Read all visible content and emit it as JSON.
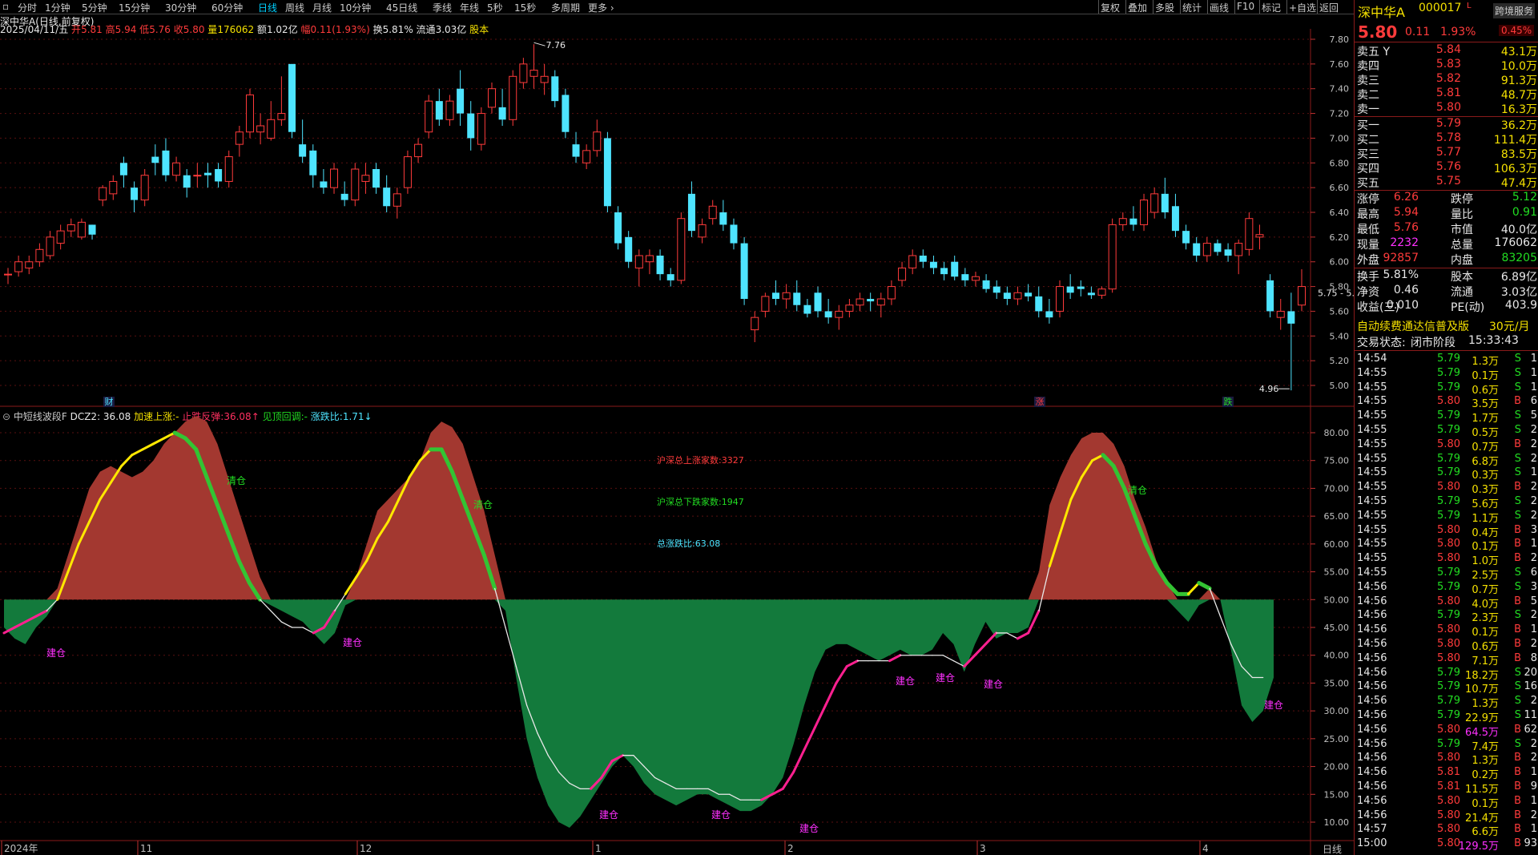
{
  "toolbar": {
    "periods": [
      "分时",
      "1分钟",
      "5分钟",
      "15分钟",
      "30分钟",
      "60分钟",
      "日线",
      "周线",
      "月线",
      "10分钟",
      "45日线",
      "季线",
      "年线",
      "5秒",
      "15秒",
      "多周期",
      "更多"
    ],
    "active": "日线",
    "right_buttons": [
      "复权",
      "叠加",
      "多股",
      "统计",
      "画线",
      "F10",
      "标记",
      "+自选",
      "返回"
    ]
  },
  "info": {
    "title": "深中华A(日线,前复权)",
    "date": "2025/04/11/五",
    "open_label": "开",
    "open": "5.81",
    "high_label": "高",
    "high": "5.94",
    "low_label": "低",
    "low": "5.76",
    "close_label": "收",
    "close": "5.80",
    "vol_label": "量",
    "vol": "176062",
    "amt_label": "额",
    "amt": "1.02亿",
    "chg_label": "幅",
    "chg": "0.11(1.93%)",
    "turn_label": "换",
    "turn": "5.81%",
    "float_label": "流通",
    "float": "3.03亿",
    "badge": "股本"
  },
  "kline": {
    "yaxis": [
      "7.80",
      "7.60",
      "7.40",
      "7.20",
      "7.00",
      "6.80",
      "6.60",
      "6.40",
      "6.20",
      "6.00",
      "5.80",
      "5.60",
      "5.40",
      "5.20",
      "5.00"
    ],
    "ymax": 7.8,
    "ymin": 5.0,
    "max_label": "7.76",
    "min_label": "4.96",
    "range_label": "5.75 - 5.76",
    "markers": [
      "财",
      "涨",
      "跌"
    ],
    "candles": [
      [
        5.9,
        5.95,
        5.82,
        5.9
      ],
      [
        5.92,
        6.05,
        5.88,
        6.0
      ],
      [
        5.95,
        6.05,
        5.9,
        6.0
      ],
      [
        6.0,
        6.15,
        5.96,
        6.1
      ],
      [
        6.05,
        6.25,
        6.02,
        6.2
      ],
      [
        6.15,
        6.3,
        6.1,
        6.25
      ],
      [
        6.25,
        6.35,
        6.2,
        6.3
      ],
      [
        6.2,
        6.35,
        6.18,
        6.32
      ],
      [
        6.3,
        6.3,
        6.18,
        6.22
      ],
      [
        6.5,
        6.62,
        6.45,
        6.6
      ],
      [
        6.55,
        6.7,
        6.5,
        6.65
      ],
      [
        6.8,
        6.85,
        6.6,
        6.7
      ],
      [
        6.6,
        6.65,
        6.4,
        6.5
      ],
      [
        6.5,
        6.75,
        6.45,
        6.7
      ],
      [
        6.85,
        6.95,
        6.7,
        6.8
      ],
      [
        6.9,
        7.0,
        6.65,
        6.7
      ],
      [
        6.7,
        6.85,
        6.65,
        6.8
      ],
      [
        6.7,
        6.75,
        6.52,
        6.6
      ],
      [
        6.7,
        6.8,
        6.6,
        6.7
      ],
      [
        6.72,
        6.8,
        6.6,
        6.7
      ],
      [
        6.75,
        6.8,
        6.6,
        6.65
      ],
      [
        6.65,
        6.9,
        6.6,
        6.85
      ],
      [
        6.95,
        7.1,
        6.85,
        7.05
      ],
      [
        7.05,
        7.4,
        7.0,
        7.35
      ],
      [
        7.05,
        7.2,
        6.95,
        7.1
      ],
      [
        7.0,
        7.3,
        6.98,
        7.15
      ],
      [
        7.15,
        7.5,
        7.1,
        7.2
      ],
      [
        7.6,
        7.6,
        7.0,
        7.05
      ],
      [
        6.95,
        7.15,
        6.8,
        6.85
      ],
      [
        6.9,
        6.95,
        6.6,
        6.7
      ],
      [
        6.65,
        6.75,
        6.55,
        6.6
      ],
      [
        6.6,
        6.8,
        6.55,
        6.75
      ],
      [
        6.55,
        6.65,
        6.45,
        6.5
      ],
      [
        6.5,
        6.8,
        6.45,
        6.75
      ],
      [
        6.65,
        6.8,
        6.55,
        6.7
      ],
      [
        6.75,
        6.8,
        6.55,
        6.6
      ],
      [
        6.6,
        6.7,
        6.4,
        6.45
      ],
      [
        6.45,
        6.6,
        6.35,
        6.55
      ],
      [
        6.6,
        6.9,
        6.55,
        6.85
      ],
      [
        6.85,
        7.0,
        6.8,
        6.95
      ],
      [
        7.05,
        7.35,
        7.0,
        7.3
      ],
      [
        7.3,
        7.4,
        7.1,
        7.15
      ],
      [
        7.15,
        7.35,
        7.1,
        7.3
      ],
      [
        7.4,
        7.55,
        7.1,
        7.2
      ],
      [
        7.2,
        7.3,
        6.9,
        7.0
      ],
      [
        6.95,
        7.25,
        6.9,
        7.2
      ],
      [
        7.25,
        7.45,
        7.2,
        7.4
      ],
      [
        7.25,
        7.4,
        7.1,
        7.15
      ],
      [
        7.15,
        7.55,
        7.1,
        7.5
      ],
      [
        7.45,
        7.65,
        7.4,
        7.6
      ],
      [
        7.5,
        7.76,
        7.4,
        7.55
      ],
      [
        7.45,
        7.6,
        7.35,
        7.5
      ],
      [
        7.5,
        7.55,
        7.25,
        7.3
      ],
      [
        7.35,
        7.4,
        7.0,
        7.05
      ],
      [
        6.95,
        7.05,
        6.8,
        6.85
      ],
      [
        6.8,
        6.95,
        6.75,
        6.9
      ],
      [
        6.9,
        7.15,
        6.85,
        7.05
      ],
      [
        7.0,
        7.05,
        6.4,
        6.45
      ],
      [
        6.4,
        6.45,
        6.1,
        6.15
      ],
      [
        6.2,
        6.25,
        5.95,
        6.0
      ],
      [
        5.95,
        6.1,
        5.8,
        6.05
      ],
      [
        6.0,
        6.1,
        5.9,
        6.05
      ],
      [
        6.05,
        6.1,
        5.85,
        5.9
      ],
      [
        5.9,
        5.95,
        5.8,
        5.85
      ],
      [
        5.85,
        6.4,
        5.82,
        6.35
      ],
      [
        6.55,
        6.65,
        6.2,
        6.25
      ],
      [
        6.2,
        6.35,
        6.15,
        6.3
      ],
      [
        6.35,
        6.5,
        6.3,
        6.45
      ],
      [
        6.4,
        6.5,
        6.25,
        6.3
      ],
      [
        6.3,
        6.35,
        6.1,
        6.15
      ],
      [
        6.15,
        6.2,
        5.65,
        5.7
      ],
      [
        5.45,
        5.6,
        5.35,
        5.55
      ],
      [
        5.6,
        5.75,
        5.55,
        5.72
      ],
      [
        5.75,
        5.85,
        5.65,
        5.7
      ],
      [
        5.7,
        5.82,
        5.62,
        5.75
      ],
      [
        5.75,
        5.85,
        5.6,
        5.65
      ],
      [
        5.65,
        5.7,
        5.55,
        5.58
      ],
      [
        5.75,
        5.8,
        5.55,
        5.6
      ],
      [
        5.6,
        5.7,
        5.5,
        5.55
      ],
      [
        5.55,
        5.65,
        5.45,
        5.6
      ],
      [
        5.6,
        5.7,
        5.55,
        5.65
      ],
      [
        5.65,
        5.75,
        5.6,
        5.7
      ],
      [
        5.7,
        5.75,
        5.6,
        5.68
      ],
      [
        5.65,
        5.75,
        5.55,
        5.7
      ],
      [
        5.7,
        5.85,
        5.65,
        5.8
      ],
      [
        5.85,
        6.0,
        5.8,
        5.95
      ],
      [
        5.95,
        6.1,
        5.9,
        6.05
      ],
      [
        6.05,
        6.1,
        5.95,
        6.0
      ],
      [
        6.0,
        6.05,
        5.9,
        5.95
      ],
      [
        5.95,
        6.0,
        5.85,
        5.9
      ],
      [
        6.0,
        6.05,
        5.85,
        5.88
      ],
      [
        5.9,
        5.95,
        5.8,
        5.85
      ],
      [
        5.85,
        5.92,
        5.8,
        5.88
      ],
      [
        5.85,
        5.9,
        5.75,
        5.78
      ],
      [
        5.8,
        5.85,
        5.7,
        5.75
      ],
      [
        5.75,
        5.8,
        5.65,
        5.7
      ],
      [
        5.7,
        5.8,
        5.65,
        5.75
      ],
      [
        5.75,
        5.82,
        5.68,
        5.72
      ],
      [
        5.72,
        5.8,
        5.55,
        5.6
      ],
      [
        5.6,
        5.7,
        5.5,
        5.55
      ],
      [
        5.6,
        5.85,
        5.55,
        5.8
      ],
      [
        5.8,
        5.9,
        5.7,
        5.75
      ],
      [
        5.8,
        5.85,
        5.72,
        5.78
      ],
      [
        5.75,
        5.8,
        5.7,
        5.73
      ],
      [
        5.73,
        5.8,
        5.7,
        5.78
      ],
      [
        5.78,
        6.35,
        5.75,
        6.3
      ],
      [
        6.3,
        6.4,
        6.25,
        6.35
      ],
      [
        6.35,
        6.45,
        6.25,
        6.3
      ],
      [
        6.3,
        6.55,
        6.25,
        6.5
      ],
      [
        6.4,
        6.6,
        6.35,
        6.55
      ],
      [
        6.55,
        6.68,
        6.35,
        6.4
      ],
      [
        6.45,
        6.55,
        6.2,
        6.25
      ],
      [
        6.25,
        6.3,
        6.1,
        6.15
      ],
      [
        6.15,
        6.2,
        6.0,
        6.05
      ],
      [
        6.05,
        6.2,
        6.0,
        6.15
      ],
      [
        6.15,
        6.18,
        6.05,
        6.08
      ],
      [
        6.1,
        6.15,
        6.0,
        6.05
      ],
      [
        6.05,
        6.18,
        5.9,
        6.15
      ],
      [
        6.1,
        6.4,
        6.05,
        6.35
      ],
      [
        6.2,
        6.3,
        6.1,
        6.22
      ],
      [
        5.85,
        5.9,
        5.55,
        5.6
      ],
      [
        5.55,
        5.7,
        5.45,
        5.6
      ],
      [
        5.6,
        5.75,
        4.96,
        5.5
      ],
      [
        5.65,
        5.94,
        5.6,
        5.8
      ]
    ]
  },
  "indicator": {
    "name": "中短线波段F",
    "dcz2_label": "DCZ2:",
    "dcz2": "36.08",
    "legend": [
      "加速上涨:-",
      "止跌反弹:36.08",
      "见顶回调:-",
      "涨跌比:1.71"
    ],
    "yaxis": [
      "80.00",
      "75.00",
      "70.00",
      "65.00",
      "60.00",
      "55.00",
      "50.00",
      "45.00",
      "40.00",
      "35.00",
      "30.00",
      "25.00",
      "20.00",
      "15.00",
      "10.00"
    ],
    "text_up": "沪深总上涨家数:3327",
    "text_down": "沪深总下跌家数:1947",
    "text_ratio": "总涨跌比:63.08",
    "label_build": "建仓",
    "label_clear": "清仓",
    "curve": [
      44,
      45,
      46,
      47,
      48,
      50,
      55,
      60,
      64,
      68,
      71,
      74,
      76,
      77,
      78,
      79,
      80,
      79,
      77,
      72,
      67,
      62,
      57,
      53,
      50,
      48,
      46,
      45,
      45,
      44,
      45,
      48,
      51,
      54,
      57,
      61,
      64,
      68,
      72,
      75,
      77,
      77,
      73,
      68,
      63,
      58,
      52,
      45,
      38,
      31,
      26,
      22,
      19,
      17,
      16,
      16,
      18,
      21,
      22,
      22,
      20,
      18,
      17,
      16,
      16,
      16,
      16,
      15,
      15,
      14,
      14,
      14,
      15,
      16,
      19,
      23,
      27,
      31,
      35,
      38,
      39,
      39,
      39,
      39,
      40,
      40,
      40,
      40,
      40,
      39,
      38,
      40,
      42,
      44,
      44,
      43,
      44,
      48,
      56,
      62,
      68,
      72,
      75,
      76,
      74,
      70,
      65,
      60,
      56,
      53,
      51,
      51,
      53,
      52,
      47,
      42,
      38,
      36,
      36
    ],
    "fill": [
      45,
      43,
      42,
      45,
      47,
      52,
      58,
      64,
      70,
      73,
      74,
      73,
      72,
      73,
      75,
      78,
      80,
      82,
      83,
      82,
      78,
      72,
      66,
      60,
      54,
      49,
      48,
      47,
      46,
      44,
      42,
      44,
      49,
      54,
      60,
      66,
      68,
      70,
      72,
      75,
      80,
      82,
      81,
      78,
      72,
      66,
      58,
      48,
      36,
      25,
      18,
      13,
      10,
      9,
      11,
      14,
      17,
      20,
      22,
      20,
      17,
      15,
      14,
      13,
      14,
      15,
      15,
      14,
      13,
      12,
      12,
      13,
      15,
      18,
      24,
      31,
      37,
      41,
      42,
      42,
      41,
      40,
      39,
      40,
      41,
      40,
      40,
      41,
      44,
      42,
      37,
      42,
      46,
      43,
      44,
      44,
      45,
      55,
      67,
      72,
      76,
      79,
      80,
      80,
      78,
      74,
      68,
      63,
      57,
      53,
      48,
      46,
      49,
      52,
      50,
      41,
      31,
      28,
      30,
      36
    ]
  },
  "xaxis": [
    "2024年",
    "11",
    "12",
    "1",
    "2",
    "3",
    "4"
  ],
  "right_panel": {
    "name": "深中华A",
    "code": "000017",
    "flag": "L",
    "button": "跨境服务",
    "price": "5.80",
    "change": "0.11",
    "pct": "1.93%",
    "pct_box": "0.45%",
    "sells": [
      {
        "label": "卖五",
        "mark": "Y",
        "price": "5.84",
        "vol": "43.1万"
      },
      {
        "label": "卖四",
        "mark": "",
        "price": "5.83",
        "vol": "10.0万"
      },
      {
        "label": "卖三",
        "mark": "",
        "price": "5.82",
        "vol": "91.3万"
      },
      {
        "label": "卖二",
        "mark": "",
        "price": "5.81",
        "vol": "48.7万"
      },
      {
        "label": "卖一",
        "mark": "",
        "price": "5.80",
        "vol": "16.3万"
      }
    ],
    "buys": [
      {
        "label": "买一",
        "price": "5.79",
        "vol": "36.2万"
      },
      {
        "label": "买二",
        "price": "5.78",
        "vol": "111.4万"
      },
      {
        "label": "买三",
        "price": "5.77",
        "vol": "83.5万"
      },
      {
        "label": "买四",
        "price": "5.76",
        "vol": "106.3万"
      },
      {
        "label": "买五",
        "price": "5.75",
        "vol": "47.4万"
      }
    ],
    "stats": [
      {
        "l1": "涨停",
        "v1": "6.26",
        "c1": "red",
        "l2": "跌停",
        "v2": "5.12",
        "c2": "grn"
      },
      {
        "l1": "最高",
        "v1": "5.94",
        "c1": "red",
        "l2": "量比",
        "v2": "0.91",
        "c2": "grn"
      },
      {
        "l1": "最低",
        "v1": "5.76",
        "c1": "red",
        "l2": "市值",
        "v2": "40.0亿",
        "c2": "wht"
      },
      {
        "l1": "现量",
        "v1": "2232",
        "c1": "mag",
        "l2": "总量",
        "v2": "176062",
        "c2": "wht"
      },
      {
        "l1": "外盘",
        "v1": "92857",
        "c1": "red",
        "l2": "内盘",
        "v2": "83205",
        "c2": "grn"
      }
    ],
    "stats2": [
      {
        "l1": "换手",
        "v1": "5.81%",
        "l2": "股本",
        "v2": "6.89亿"
      },
      {
        "l1": "净资",
        "v1": "0.46",
        "l2": "流通",
        "v2": "3.03亿"
      },
      {
        "l1": "收益(三)",
        "v1": "0.010",
        "l2": "PE(动)",
        "v2": "403.9"
      }
    ],
    "promo": "自动续费通达信普及版",
    "promo_price": "30元/月",
    "status_label": "交易状态:",
    "status": "闭市阶段",
    "time": "15:33:43",
    "ticks": [
      [
        "14:54",
        "5.79",
        "1.3万",
        "S",
        "1"
      ],
      [
        "14:55",
        "5.79",
        "0.1万",
        "S",
        "1"
      ],
      [
        "14:55",
        "5.79",
        "0.6万",
        "S",
        "1"
      ],
      [
        "14:55",
        "5.80",
        "3.5万",
        "B",
        "6"
      ],
      [
        "14:55",
        "5.79",
        "1.7万",
        "S",
        "5"
      ],
      [
        "14:55",
        "5.79",
        "0.5万",
        "S",
        "2"
      ],
      [
        "14:55",
        "5.80",
        "0.7万",
        "B",
        "2"
      ],
      [
        "14:55",
        "5.79",
        "6.8万",
        "S",
        "2"
      ],
      [
        "14:55",
        "5.79",
        "0.3万",
        "S",
        "1"
      ],
      [
        "14:55",
        "5.80",
        "0.3万",
        "B",
        "2"
      ],
      [
        "14:55",
        "5.79",
        "5.6万",
        "S",
        "2"
      ],
      [
        "14:55",
        "5.79",
        "1.1万",
        "S",
        "2"
      ],
      [
        "14:55",
        "5.80",
        "0.4万",
        "B",
        "3"
      ],
      [
        "14:55",
        "5.80",
        "0.1万",
        "B",
        "1"
      ],
      [
        "14:55",
        "5.80",
        "1.0万",
        "B",
        "2"
      ],
      [
        "14:55",
        "5.79",
        "2.5万",
        "S",
        "6"
      ],
      [
        "14:56",
        "5.79",
        "0.7万",
        "S",
        "3"
      ],
      [
        "14:56",
        "5.80",
        "4.0万",
        "B",
        "5"
      ],
      [
        "14:56",
        "5.79",
        "2.3万",
        "S",
        "2"
      ],
      [
        "14:56",
        "5.80",
        "0.1万",
        "B",
        "1"
      ],
      [
        "14:56",
        "5.80",
        "0.6万",
        "B",
        "2"
      ],
      [
        "14:56",
        "5.80",
        "7.1万",
        "B",
        "8"
      ],
      [
        "14:56",
        "5.79",
        "18.2万",
        "S",
        "20"
      ],
      [
        "14:56",
        "5.79",
        "10.7万",
        "S",
        "16"
      ],
      [
        "14:56",
        "5.79",
        "1.3万",
        "S",
        "2"
      ],
      [
        "14:56",
        "5.79",
        "22.9万",
        "S",
        "11"
      ],
      [
        "14:56",
        "5.80",
        "64.5万",
        "B",
        "62"
      ],
      [
        "14:56",
        "5.79",
        "7.4万",
        "S",
        "2"
      ],
      [
        "14:56",
        "5.80",
        "1.3万",
        "B",
        "2"
      ],
      [
        "14:56",
        "5.81",
        "0.2万",
        "B",
        "1"
      ],
      [
        "14:56",
        "5.81",
        "11.5万",
        "B",
        "9"
      ],
      [
        "14:56",
        "5.80",
        "0.1万",
        "B",
        "1"
      ],
      [
        "14:56",
        "5.80",
        "21.4万",
        "B",
        "2"
      ],
      [
        "14:57",
        "5.80",
        "6.6万",
        "B",
        "1"
      ],
      [
        "15:00",
        "5.80",
        "129.5万",
        "B",
        "93"
      ]
    ]
  },
  "bottom_right": "日线"
}
